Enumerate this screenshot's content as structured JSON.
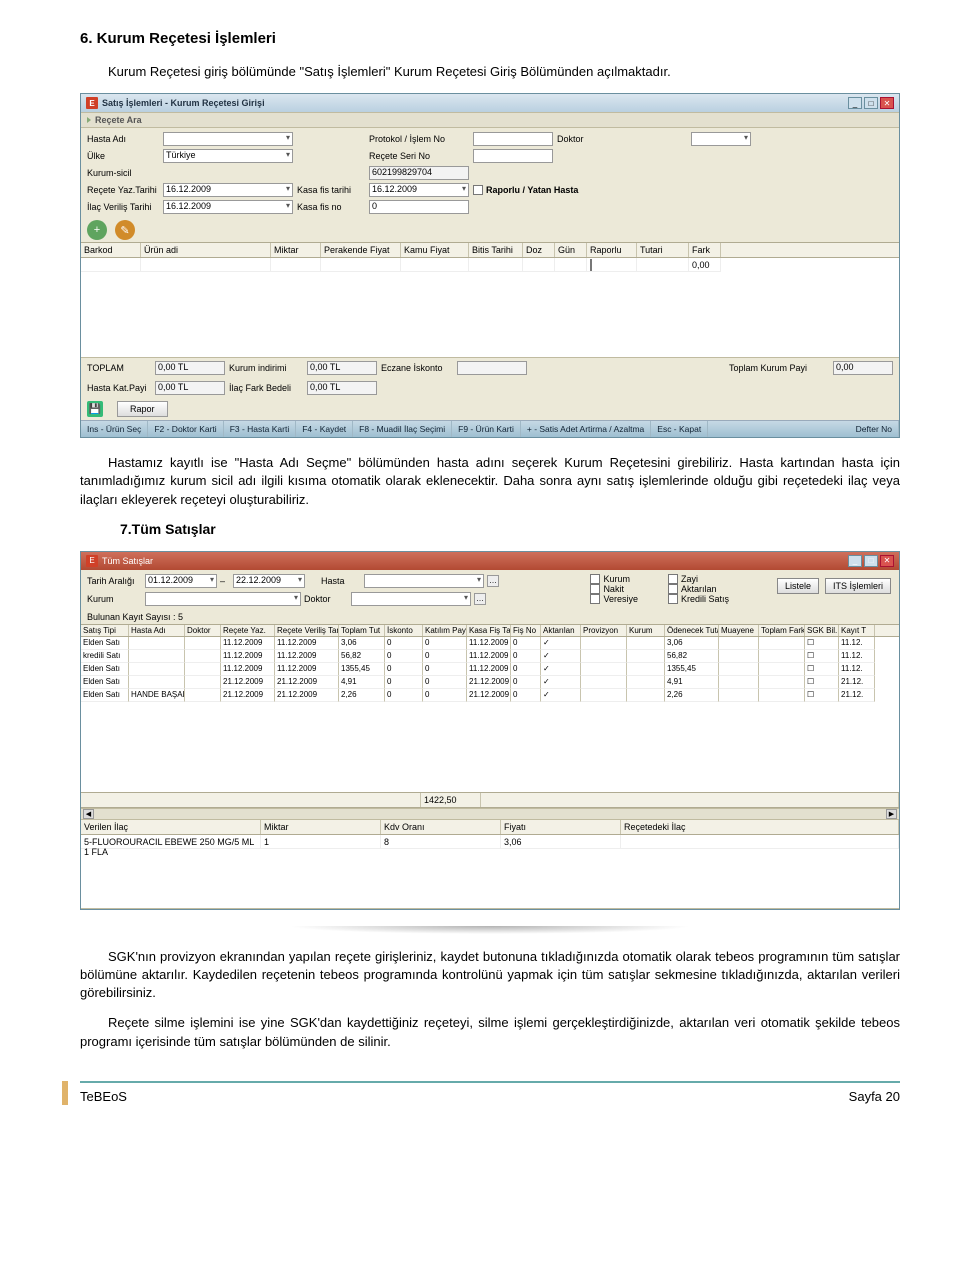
{
  "doc": {
    "h1": "6. Kurum Reçetesi İşlemleri",
    "p1": "Kurum Reçetesi giriş bölümünde \"Satış İşlemleri\" Kurum Reçetesi Giriş Bölümünden açılmaktadır.",
    "p2": "Hastamız kayıtlı ise \"Hasta Adı Seçme\" bölümünden hasta adını seçerek Kurum Reçetesini girebiliriz. Hasta kartından hasta için tanımladığımız kurum sicil adı ilgili kısıma otomatik olarak eklenecektir. Daha sonra aynı satış işlemlerinde olduğu gibi reçetedeki ilaç veya ilaçları ekleyerek reçeteyi oluşturabiliriz.",
    "h2": "7.Tüm Satışlar",
    "p3": "SGK'nın provizyon ekranından yapılan reçete girişleriniz, kaydet butonuna tıkladığınızda otomatik olarak tebeos programının tüm satışlar bölümüne aktarılır. Kaydedilen reçetenin tebeos programında kontrolünü yapmak için tüm satışlar sekmesine tıkladığınızda, aktarılan verileri görebilirsiniz.",
    "p4": "Reçete silme işlemini ise yine SGK'dan kaydettiğiniz reçeteyi, silme işlemi gerçekleştirdiğinizde, aktarılan veri otomatik şekilde tebeos programı içerisinde tüm satışlar bölümünden de silinir.",
    "footer_left": "TeBEoS",
    "footer_right": "Sayfa 20"
  },
  "win1": {
    "title": "Satış İşlemleri - Kurum Reçetesi Girişi",
    "section_search": "Reçete Ara",
    "labels": {
      "hasta_adi": "Hasta Adı",
      "protokol": "Protokol / İşlem No",
      "doktor": "Doktor",
      "ulke": "Ülke",
      "ulke_val": "Türkiye",
      "recete_seri": "Reçete Seri No",
      "kurum_sicil": "Kurum-sicil",
      "kurum_sicil_val": "602199829704",
      "recete_yaz": "Reçete Yaz.Tarihi",
      "recete_yaz_val": "16.12.2009",
      "kasa_fis_tarihi": "Kasa fis tarihi",
      "kasa_fis_tarihi_val": "16.12.2009",
      "raporlu": "Raporlu / Yatan Hasta",
      "ilac_verilis": "İlaç Veriliş Tarihi",
      "ilac_verilis_val": "16.12.2009",
      "kasa_fis_no": "Kasa fis no",
      "kasa_fis_no_val": "0"
    },
    "grid_cols": [
      "Barkod",
      "Ürün adi",
      "Miktar",
      "Perakende Fiyat",
      "Kamu Fiyat",
      "Bitis Tarihi",
      "Doz",
      "Gün",
      "Raporlu",
      "Tutari",
      "Fark"
    ],
    "grid_val_fark": "0,00",
    "totals": {
      "toplam": "TOPLAM",
      "toplam_v": "0,00 TL",
      "kurum_ind": "Kurum indirimi",
      "kurum_ind_v": "0,00 TL",
      "eczane_isk": "Eczane İskonto",
      "toplam_kurum": "Toplam Kurum Payi",
      "toplam_kurum_v": "0,00",
      "hasta_kat": "Hasta Kat.Payi",
      "hasta_kat_v": "0,00 TL",
      "ilac_fark": "İlaç Fark Bedeli",
      "ilac_fark_v": "0,00 TL"
    },
    "rapor_btn": "Rapor",
    "shortcuts": [
      "Ins - Ürün Seç",
      "F2 - Doktor Karti",
      "F3 - Hasta Karti",
      "F4 - Kaydet",
      "F8 - Muadil İlaç Seçimi",
      "F9 - Ürün Karti",
      "+ - Satis Adet Artirma / Azaltma",
      "Esc - Kapat",
      "Defter No"
    ]
  },
  "win2": {
    "title": "Tüm Satışlar",
    "labels": {
      "tarih_araligi": "Tarih Aralığı",
      "d1": "01.12.2009",
      "d2": "22.12.2009",
      "hasta": "Hasta",
      "kurum": "Kurum",
      "doktor": "Doktor",
      "bulunan": "Bulunan Kayıt Sayısı : 5",
      "listele": "Listele",
      "its": "ITS İşlemleri"
    },
    "checks": [
      "Kurum",
      "Nakit",
      "Veresiye",
      "Zayi",
      "Aktarılan",
      "Kredili Satış"
    ],
    "grid_cols": [
      "Satış Tipi",
      "Hasta Adı",
      "Doktor",
      "Reçete Yaz.",
      "Reçete Veriliş Tarih",
      "Toplam Tut",
      "İskonto",
      "Katılım Payı",
      "Kasa Fiş Tar",
      "Fiş No",
      "Aktarılan",
      "Provizyon",
      "Kurum",
      "Ödenecek Tutar",
      "Muayene",
      "Toplam Fark",
      "SGK Bil.",
      "Kayıt T"
    ],
    "rows": [
      {
        "tip": "Elden Satı",
        "hasta": "",
        "dok": "",
        "ry": "11.12.2009",
        "rv": "11.12.2009",
        "tt": "3,06",
        "isk": "0",
        "kp": "0",
        "kft": "11.12.2009",
        "fno": "0",
        "akt": "✓",
        "pr": "",
        "kr": "",
        "ot": "3,06",
        "mu": "",
        "tf": "",
        "sgk": "☐",
        "kt": "11.12."
      },
      {
        "tip": "kredili Satı",
        "hasta": "",
        "dok": "",
        "ry": "11.12.2009",
        "rv": "11.12.2009",
        "tt": "56,82",
        "isk": "0",
        "kp": "0",
        "kft": "11.12.2009",
        "fno": "0",
        "akt": "✓",
        "pr": "",
        "kr": "",
        "ot": "56,82",
        "mu": "",
        "tf": "",
        "sgk": "☐",
        "kt": "11.12."
      },
      {
        "tip": "Elden Satı",
        "hasta": "",
        "dok": "",
        "ry": "11.12.2009",
        "rv": "11.12.2009",
        "tt": "1355,45",
        "isk": "0",
        "kp": "0",
        "kft": "11.12.2009",
        "fno": "0",
        "akt": "✓",
        "pr": "",
        "kr": "",
        "ot": "1355,45",
        "mu": "",
        "tf": "",
        "sgk": "☐",
        "kt": "11.12."
      },
      {
        "tip": "Elden Satı",
        "hasta": "",
        "dok": "",
        "ry": "21.12.2009",
        "rv": "21.12.2009",
        "tt": "4,91",
        "isk": "0",
        "kp": "0",
        "kft": "21.12.2009",
        "fno": "0",
        "akt": "✓",
        "pr": "",
        "kr": "",
        "ot": "4,91",
        "mu": "",
        "tf": "",
        "sgk": "☐",
        "kt": "21.12."
      },
      {
        "tip": "Elden Satı",
        "hasta": "HANDE BAŞARAN",
        "dok": "",
        "ry": "21.12.2009",
        "rv": "21.12.2009",
        "tt": "2,26",
        "isk": "0",
        "kp": "0",
        "kft": "21.12.2009",
        "fno": "0",
        "akt": "✓",
        "pr": "",
        "kr": "",
        "ot": "2,26",
        "mu": "",
        "tf": "",
        "sgk": "☐",
        "kt": "21.12."
      }
    ],
    "total": "1422,50",
    "sub_cols": [
      "Verilen İlaç",
      "Miktar",
      "Kdv Oranı",
      "Fiyatı",
      "Reçetedeki İlaç"
    ],
    "sub_row": {
      "ilac": "5-FLUOROURACIL EBEWE 250 MG/5 ML 1 FLA",
      "miktar": "1",
      "kdv": "8",
      "fiyat": "3,06",
      "recete": ""
    }
  }
}
